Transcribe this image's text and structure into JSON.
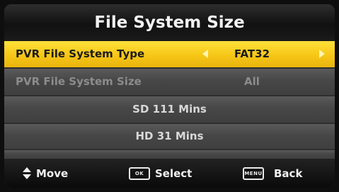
{
  "title": "File System Size",
  "rows": [
    {
      "label": "PVR File System Type",
      "value": "FAT32"
    },
    {
      "label": "PVR File System Size",
      "value": "All"
    }
  ],
  "info_lines": [
    "SD 111 Mins",
    "HD 31 Mins"
  ],
  "footer": {
    "move": {
      "icon": "up-down-arrows-icon",
      "label": "Move"
    },
    "select": {
      "icon": "ok-key-icon",
      "key_text": "OK",
      "label": "Select"
    },
    "back": {
      "icon": "menu-key-icon",
      "key_text": "MENU",
      "label": "Back"
    }
  },
  "colors": {
    "highlight": "#f6c617",
    "panel": "#484848",
    "title_bar": "#111111"
  }
}
